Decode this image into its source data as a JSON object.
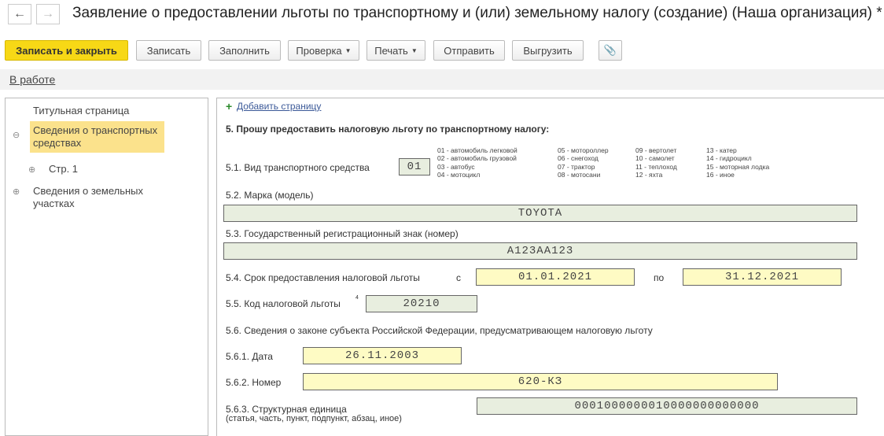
{
  "window": {
    "title": "Заявление о предоставлении льготы по транспортному и (или) земельному налогу (создание) (Наша организация) *"
  },
  "toolbar": {
    "save_close": "Записать и закрыть",
    "save": "Записать",
    "fill": "Заполнить",
    "check": "Проверка",
    "print": "Печать",
    "send": "Отправить",
    "export": "Выгрузить"
  },
  "status": "В работе",
  "tree": {
    "items": [
      "Титульная страница",
      "Сведения о транспортных средствах",
      "Стр. 1",
      "Сведения о земельных участках"
    ]
  },
  "form": {
    "add_page": "Добавить страницу",
    "heading": "5. Прошу предоставить налоговую льготу по транспортному налогу:",
    "vehicle_type_label": "5.1. Вид транспортного средства",
    "vehicle_type": "01",
    "legend": [
      [
        "01 - автомобиль легковой",
        "02 - автомобиль грузовой",
        "03 - автобус",
        "04 - мотоцикл"
      ],
      [
        "05 - мотороллер",
        "06 - снегоход",
        "07 - трактор",
        "08 - мотосани"
      ],
      [
        "09 - вертолет",
        "10 - самолет",
        "11 - теплоход",
        "12 - яхта"
      ],
      [
        "13 - катер",
        "14 - гидроцикл",
        "15 - моторная лодка",
        "16 - иное"
      ]
    ],
    "brand_label": "5.2. Марка (модель)",
    "brand": "TOYOTA",
    "reg_label": "5.3. Государственный регистрационный знак (номер)",
    "reg": "A123AA123",
    "period_label": "5.4. Срок предоставления налоговой льготы",
    "from_label": "с",
    "from": "01.01.2021",
    "to_label": "по",
    "to": "31.12.2021",
    "code_label": "5.5. Код налоговой льготы",
    "code_note": "4",
    "code": "20210",
    "law_label": "5.6. Сведения о законе субъекта Российской Федерации, предусматривающем налоговую льготу",
    "date_label": "5.6.1. Дата",
    "date": "26.11.2003",
    "number_label": "5.6.2. Номер",
    "number": "620-КЗ",
    "unit_label": "5.6.3. Структурная единица",
    "unit_sub": "(статья, часть, пункт, подпункт, абзац, иное)",
    "unit": "0001000000010000000000000"
  }
}
